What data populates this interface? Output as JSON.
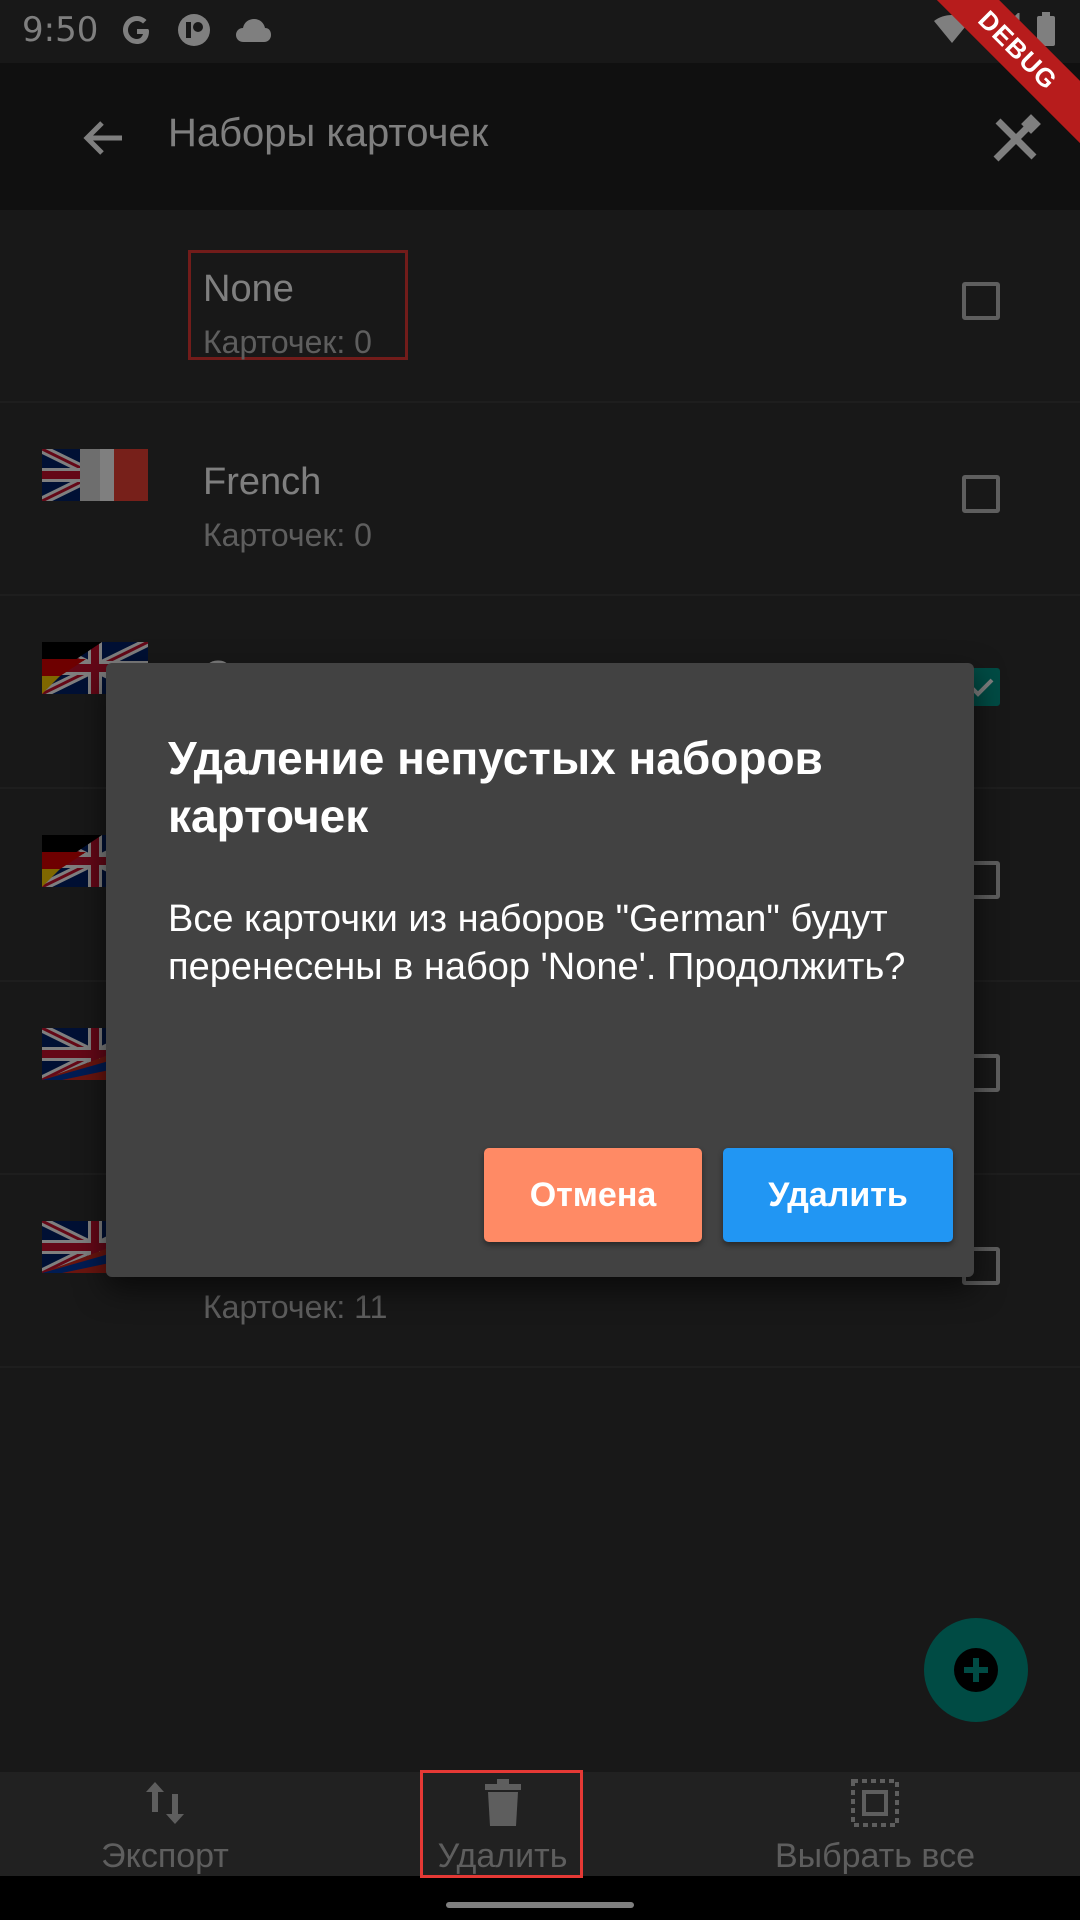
{
  "status_bar": {
    "time": "9:50"
  },
  "app_bar": {
    "title": "Наборы карточек"
  },
  "debug_banner": "DEBUG",
  "list": {
    "items": [
      {
        "name": "None",
        "count": "Карточек: 0",
        "checked": false,
        "flag": "none"
      },
      {
        "name": "French",
        "count": "Карточек: 0",
        "checked": false,
        "flag": "uk-france"
      },
      {
        "name": "German",
        "count": "",
        "checked": true,
        "flag": "germany-uk"
      },
      {
        "name": "",
        "count": "",
        "checked": false,
        "flag": "germany-uk"
      },
      {
        "name": "",
        "count": "",
        "checked": false,
        "flag": "uk-russia"
      },
      {
        "name": "",
        "count": "Карточек: 11",
        "checked": false,
        "flag": "uk-russia"
      }
    ]
  },
  "dialog": {
    "title": "Удаление непустых наборов карточек",
    "message": "Все карточки из наборов \"German\" будут перенесены в набор 'None'. Продолжить?",
    "cancel_label": "Отмена",
    "delete_label": "Удалить"
  },
  "bottom_nav": {
    "export_label": "Экспорт",
    "delete_label": "Удалить",
    "select_all_label": "Выбрать все"
  },
  "colors": {
    "accent": "#009688",
    "cancel_button": "#ff8a65",
    "delete_button": "#2196f3",
    "highlight": "#e53935"
  }
}
